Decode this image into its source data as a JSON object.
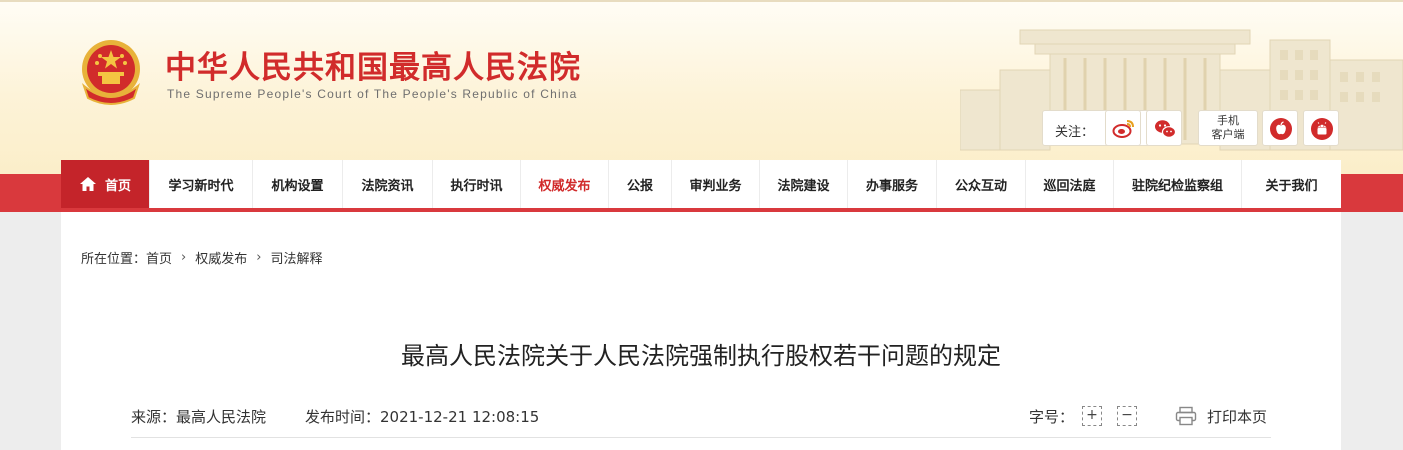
{
  "header": {
    "title": "中华人民共和国最高人民法院",
    "subtitle": "The Supreme People's Court of The People's Republic of China",
    "follow_label": "关注：",
    "client_line1": "手机",
    "client_line2": "客户端"
  },
  "nav": {
    "items": [
      {
        "label": "首页"
      },
      {
        "label": "学习新时代"
      },
      {
        "label": "机构设置"
      },
      {
        "label": "法院资讯"
      },
      {
        "label": "执行时讯"
      },
      {
        "label": "权威发布"
      },
      {
        "label": "公报"
      },
      {
        "label": "审判业务"
      },
      {
        "label": "法院建设"
      },
      {
        "label": "办事服务"
      },
      {
        "label": "公众互动"
      },
      {
        "label": "巡回法庭"
      },
      {
        "label": "驻院纪检监察组"
      },
      {
        "label": "关于我们"
      }
    ]
  },
  "breadcrumb": {
    "prefix": "所在位置：",
    "items": [
      "首页",
      "权威发布",
      "司法解释"
    ]
  },
  "article": {
    "title": "最高人民法院关于人民法院强制执行股权若干问题的规定",
    "source": "来源：最高人民法院",
    "publish_time": "发布时间：2021-12-21 12:08:15",
    "font_size_label": "字号：",
    "font_increase": "+",
    "font_decrease": "−",
    "print_label": "打印本页"
  },
  "colors": {
    "brand_red": "#d12b2b",
    "nav_band": "#d9393d",
    "home_bg": "#c4242a"
  }
}
